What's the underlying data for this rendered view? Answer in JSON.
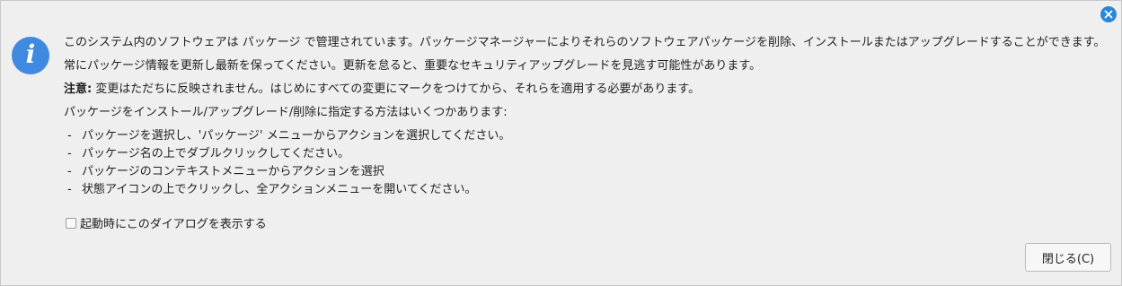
{
  "dialog": {
    "paragraphs": {
      "p1": "このシステム内のソフトウェアは パッケージ で管理されています。パッケージマネージャーによりそれらのソフトウェアパッケージを削除、インストールまたはアップグレードすることができます。",
      "p2": "常にパッケージ情報を更新し最新を保ってください。更新を怠ると、重要なセキュリティアップグレードを見逃す可能性があります。",
      "note_label": "注意:",
      "note_text": " 変更はただちに反映されません。はじめにすべての変更にマークをつけてから、それらを適用する必要があります。",
      "p4": "パッケージをインストール/アップグレード/削除に指定する方法はいくつかあります:"
    },
    "methods": [
      "パッケージを選択し、'パッケージ' メニューからアクションを選択してください。",
      "パッケージ名の上でダブルクリックしてください。",
      "パッケージのコンテキストメニューからアクションを選択",
      "状態アイコンの上でクリックし、全アクションメニューを開いてください。"
    ],
    "method_dash": "-",
    "checkbox_label": "起動時にこのダイアログを表示する",
    "checkbox_checked": false,
    "close_button_label": "閉じる(C)",
    "info_icon_glyph": "i",
    "close_icon": "close-icon",
    "accent_color": "#3f8ae0"
  }
}
